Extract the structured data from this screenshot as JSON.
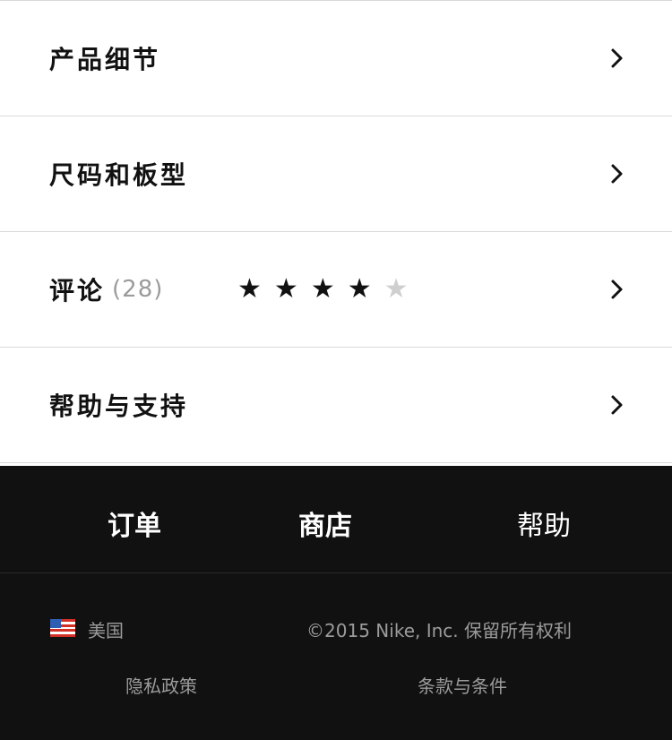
{
  "accordion": {
    "items": [
      {
        "label": "产品细节"
      },
      {
        "label": "尺码和板型"
      },
      {
        "label": "评论",
        "count": "(28)"
      },
      {
        "label": "帮助与支持"
      }
    ],
    "rating": {
      "filled": 4,
      "total": 5
    }
  },
  "icons": {
    "row_chevron": "chevron-right-icon",
    "star": "star-icon",
    "flag": "us-flag-icon"
  },
  "colors": {
    "footer_background": "#111111",
    "star_filled": "#111111",
    "star_empty": "#cfcfcf",
    "muted_text": "#9b9b9b"
  },
  "footer": {
    "nav": [
      {
        "label": "订单"
      },
      {
        "label": "商店"
      },
      {
        "label": "帮助"
      }
    ],
    "country": "美国",
    "copyright": "©2015 Nike, Inc. 保留所有权利",
    "links": [
      {
        "label": "隐私政策"
      },
      {
        "label": "条款与条件"
      }
    ]
  }
}
